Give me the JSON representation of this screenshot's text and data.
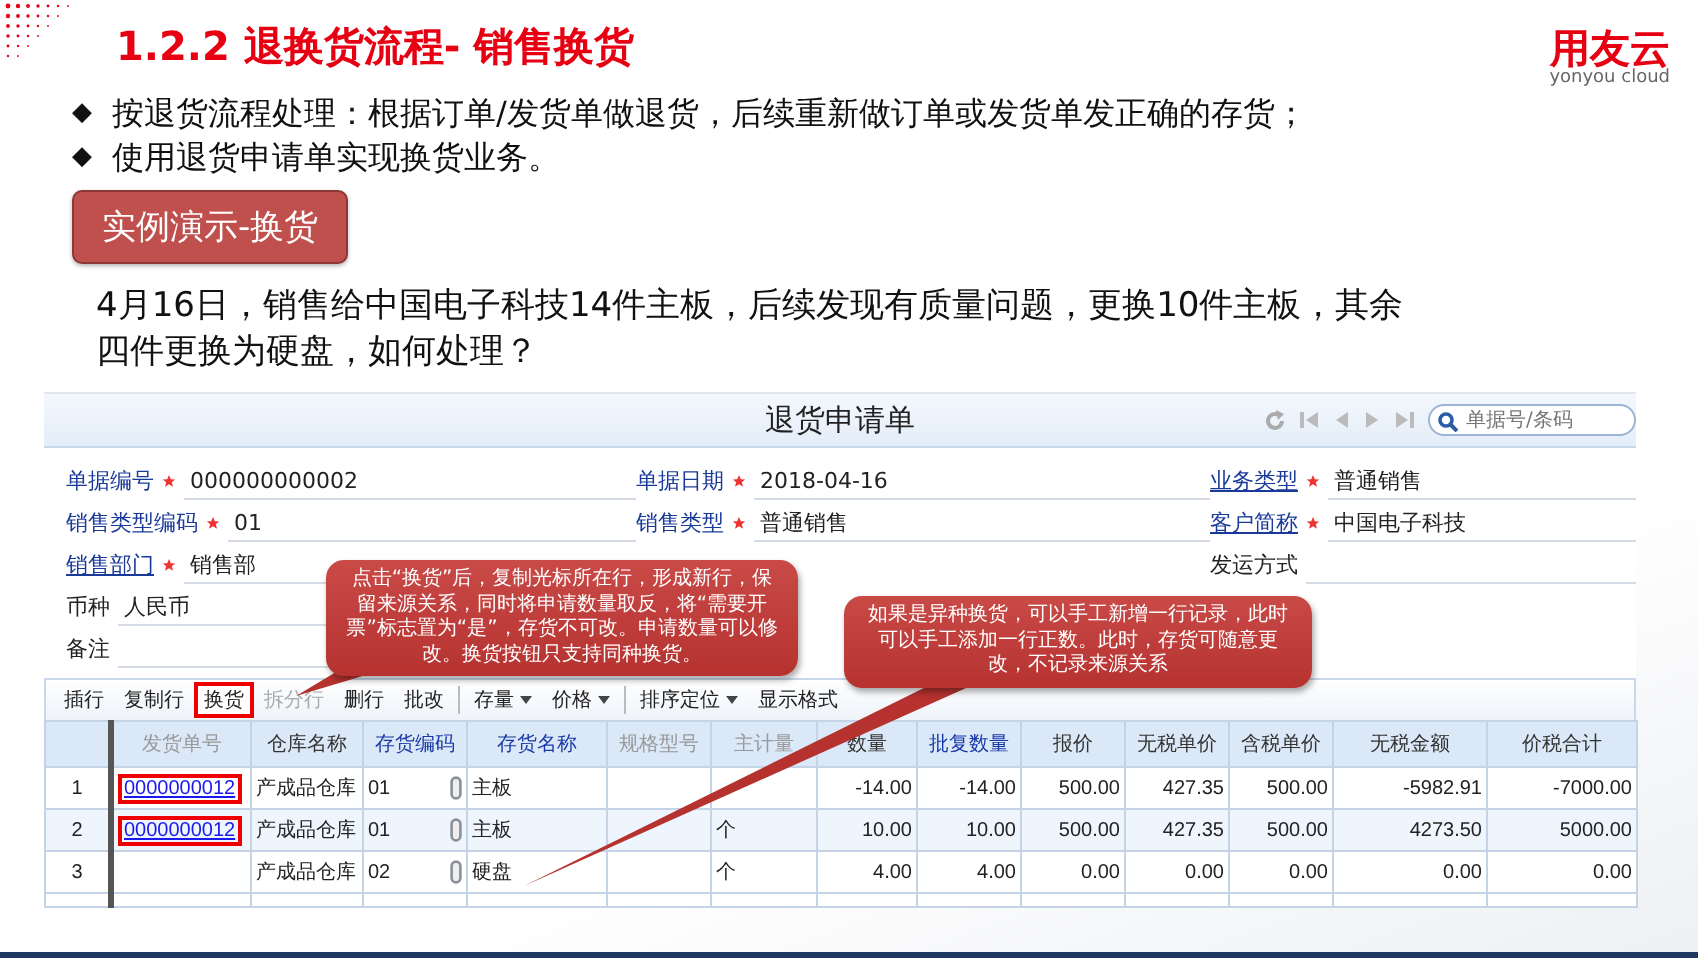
{
  "slide": {
    "title": "1.2.2 退换货流程- 销售换货",
    "logo": {
      "brand": "用友云",
      "tagline": "yonyou cloud"
    }
  },
  "bullets": [
    {
      "marker": "◆",
      "text": "按退货流程处理：根据订单/发货单做退货，后续重新做订单或发货单发正确的存货；"
    },
    {
      "marker": "◆",
      "text": "使用退货申请单实现换货业务。"
    }
  ],
  "demo_button": "实例演示-换货",
  "question": "4月16日，销售给中国电子科技14件主板，后续发现有质量问题，更换10件主板，其余四件更换为硬盘，如何处理？",
  "window": {
    "title": "退货申请单",
    "search": {
      "placeholder": "单据号/条码"
    },
    "form_columns": [
      [
        {
          "label": "单据编号",
          "required": true,
          "link": false,
          "value": "000000000002"
        },
        {
          "label": "销售类型编码",
          "required": true,
          "link": false,
          "value": "01"
        },
        {
          "label": "销售部门",
          "required": true,
          "link": true,
          "value": "销售部"
        },
        {
          "label": "币种",
          "required": false,
          "link": false,
          "value": "人民币"
        },
        {
          "label": "备注",
          "required": false,
          "link": false
        }
      ],
      [
        {
          "label": "单据日期",
          "required": true,
          "link": false,
          "value": "2018-04-16"
        },
        {
          "label": "销售类型",
          "required": true,
          "link": false,
          "value": "普通销售"
        }
      ],
      [
        {
          "label": "业务类型",
          "required": true,
          "link": true,
          "value": "普通销售"
        },
        {
          "label": "客户简称",
          "required": true,
          "link": true,
          "value": "中国电子科技"
        },
        {
          "label": "发运方式",
          "required": false,
          "link": false
        }
      ]
    ],
    "toolbar": [
      {
        "label": "插行",
        "disabled": false,
        "dropdown": false,
        "highlighted": false
      },
      {
        "label": "复制行",
        "disabled": false,
        "dropdown": false,
        "highlighted": false
      },
      {
        "label": "换货",
        "disabled": false,
        "dropdown": false,
        "highlighted": true
      },
      {
        "label": "拆分行",
        "disabled": true,
        "dropdown": false,
        "highlighted": false
      },
      {
        "label": "删行",
        "disabled": false,
        "dropdown": false,
        "highlighted": false
      },
      {
        "label": "批改",
        "disabled": false,
        "dropdown": false,
        "highlighted": false
      },
      {
        "label": "存量",
        "disabled": false,
        "dropdown": true,
        "highlighted": false
      },
      {
        "label": "价格",
        "disabled": false,
        "dropdown": true,
        "highlighted": false
      },
      {
        "label": "排序定位",
        "disabled": false,
        "dropdown": true,
        "highlighted": false
      },
      {
        "label": "显示格式",
        "disabled": false,
        "dropdown": false,
        "highlighted": false
      }
    ],
    "table": {
      "columns": [
        {
          "label": "发货单号",
          "kind": "muted"
        },
        {
          "label": "仓库名称",
          "kind": "plain"
        },
        {
          "label": "存货编码",
          "kind": "link"
        },
        {
          "label": "存货名称",
          "kind": "link"
        },
        {
          "label": "规格型号",
          "kind": "muted"
        },
        {
          "label": "主计量",
          "kind": "muted"
        },
        {
          "label": "数量",
          "kind": "plain"
        },
        {
          "label": "批复数量",
          "kind": "link"
        },
        {
          "label": "报价",
          "kind": "plain"
        },
        {
          "label": "无税单价",
          "kind": "plain"
        },
        {
          "label": "含税单价",
          "kind": "plain"
        },
        {
          "label": "无税金额",
          "kind": "plain"
        },
        {
          "label": "价税合计",
          "kind": "plain"
        }
      ],
      "rows": [
        {
          "number": "1",
          "source_highlighted": true,
          "attachment": true,
          "cells": [
            "0000000012",
            "产成品仓库",
            "01",
            "主板",
            "",
            "",
            "-14.00",
            "-14.00",
            "500.00",
            "427.35",
            "500.00",
            "-5982.91",
            "-7000.00"
          ]
        },
        {
          "number": "2",
          "source_highlighted": true,
          "attachment": true,
          "cells": [
            "0000000012",
            "产成品仓库",
            "01",
            "主板",
            "",
            "个",
            "10.00",
            "10.00",
            "500.00",
            "427.35",
            "500.00",
            "4273.50",
            "5000.00"
          ]
        },
        {
          "number": "3",
          "attachment": true,
          "cells": [
            "",
            "产成品仓库",
            "02",
            "硬盘",
            "",
            "个",
            "4.00",
            "4.00",
            "0.00",
            "0.00",
            "0.00",
            "0.00",
            "0.00"
          ]
        }
      ]
    }
  },
  "callouts": [
    {
      "text": "点击“换货”后，复制光标所在行，形成新行，保留来源关系，同时将申请数量取反，将“需要开票”标志置为“是”，存货不可改。申请数量可以修改。换货按钮只支持同种换货。"
    },
    {
      "text": "如果是异种换货，可以手工新增一行记录，此时可以手工添加一行正数。此时，存货可随意更改，不记录来源关系"
    }
  ]
}
